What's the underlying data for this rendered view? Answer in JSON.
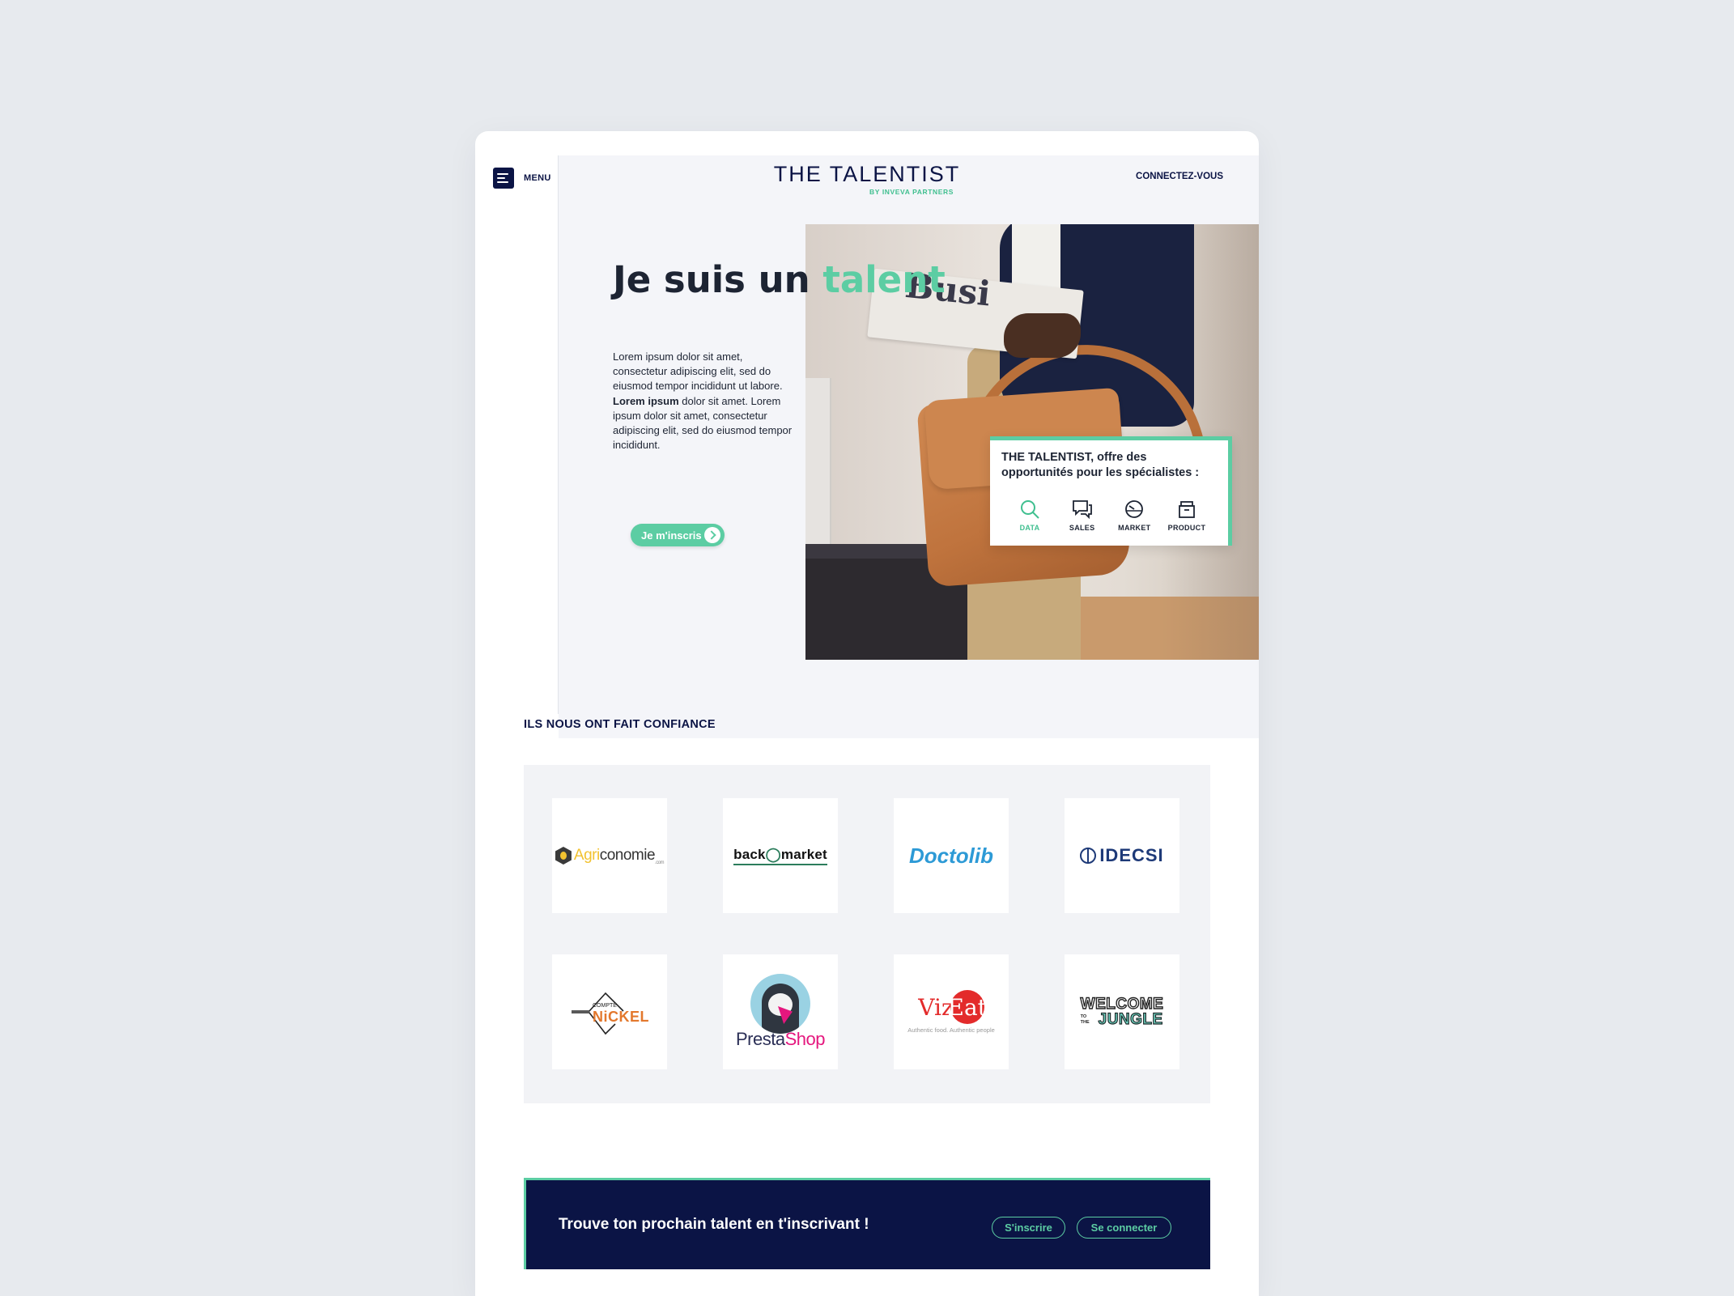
{
  "header": {
    "menu_label": "MENU",
    "logo_title": "THE TALENTIST",
    "logo_subtitle": "BY INVEVA PARTNERS",
    "connect_label": "CONNECTEZ-VOUS"
  },
  "hero": {
    "title_prefix": "Je suis un ",
    "title_accent": "talent",
    "body_part1": "Lorem ipsum dolor sit amet, consectetur adipiscing elit, sed do eiusmod tempor incididunt ut labore. ",
    "body_bold": "Lorem ipsum",
    "body_part2": " dolor sit amet. Lorem ipsum dolor sit amet, consectetur adipiscing elit, sed do eiusmod tempor incididunt.",
    "cta_label": "Je m'inscris",
    "newspaper_text": "Busi"
  },
  "offer": {
    "brand": "THE TALENTIST",
    "title_rest": ", offre des opportunités pour les spécialistes :",
    "items": [
      {
        "label": "DATA",
        "icon": "search-icon",
        "active": true
      },
      {
        "label": "SALES",
        "icon": "chat-icon",
        "active": false
      },
      {
        "label": "MARKET",
        "icon": "gauge-icon",
        "active": false
      },
      {
        "label": "PRODUCT",
        "icon": "box-icon",
        "active": false
      }
    ]
  },
  "trust": {
    "heading": "ILS NOUS ONT FAIT CONFIANCE",
    "logos": {
      "agriconomie": {
        "pre": "Agri",
        "post": "conomie",
        "com": ".com"
      },
      "backmarket": {
        "pre": "back",
        "mid": "◯",
        "post": "market"
      },
      "doctolib": "Doctolib",
      "idecsi": "IDECSI",
      "nickel": {
        "small": "COMPTE",
        "big": "NiCKEL"
      },
      "prestashop": {
        "pre": "Presta",
        "post": "Shop"
      },
      "vizeat": {
        "pre": "Viz",
        "post": "Eat",
        "tagline": "Authentic food. Authentic people"
      },
      "wttj": {
        "top": "WELCOME",
        "small": "TO THE",
        "bottom": "JUNGLE"
      }
    }
  },
  "banner": {
    "text": "Trouve ton prochain talent en t'inscrivant !",
    "signup_label": "S'inscrire",
    "login_label": "Se connecter"
  },
  "colors": {
    "navy": "#0b1445",
    "accent": "#5ccda3",
    "page_bg": "#e7eaee",
    "panel_bg": "#f4f5f9"
  }
}
